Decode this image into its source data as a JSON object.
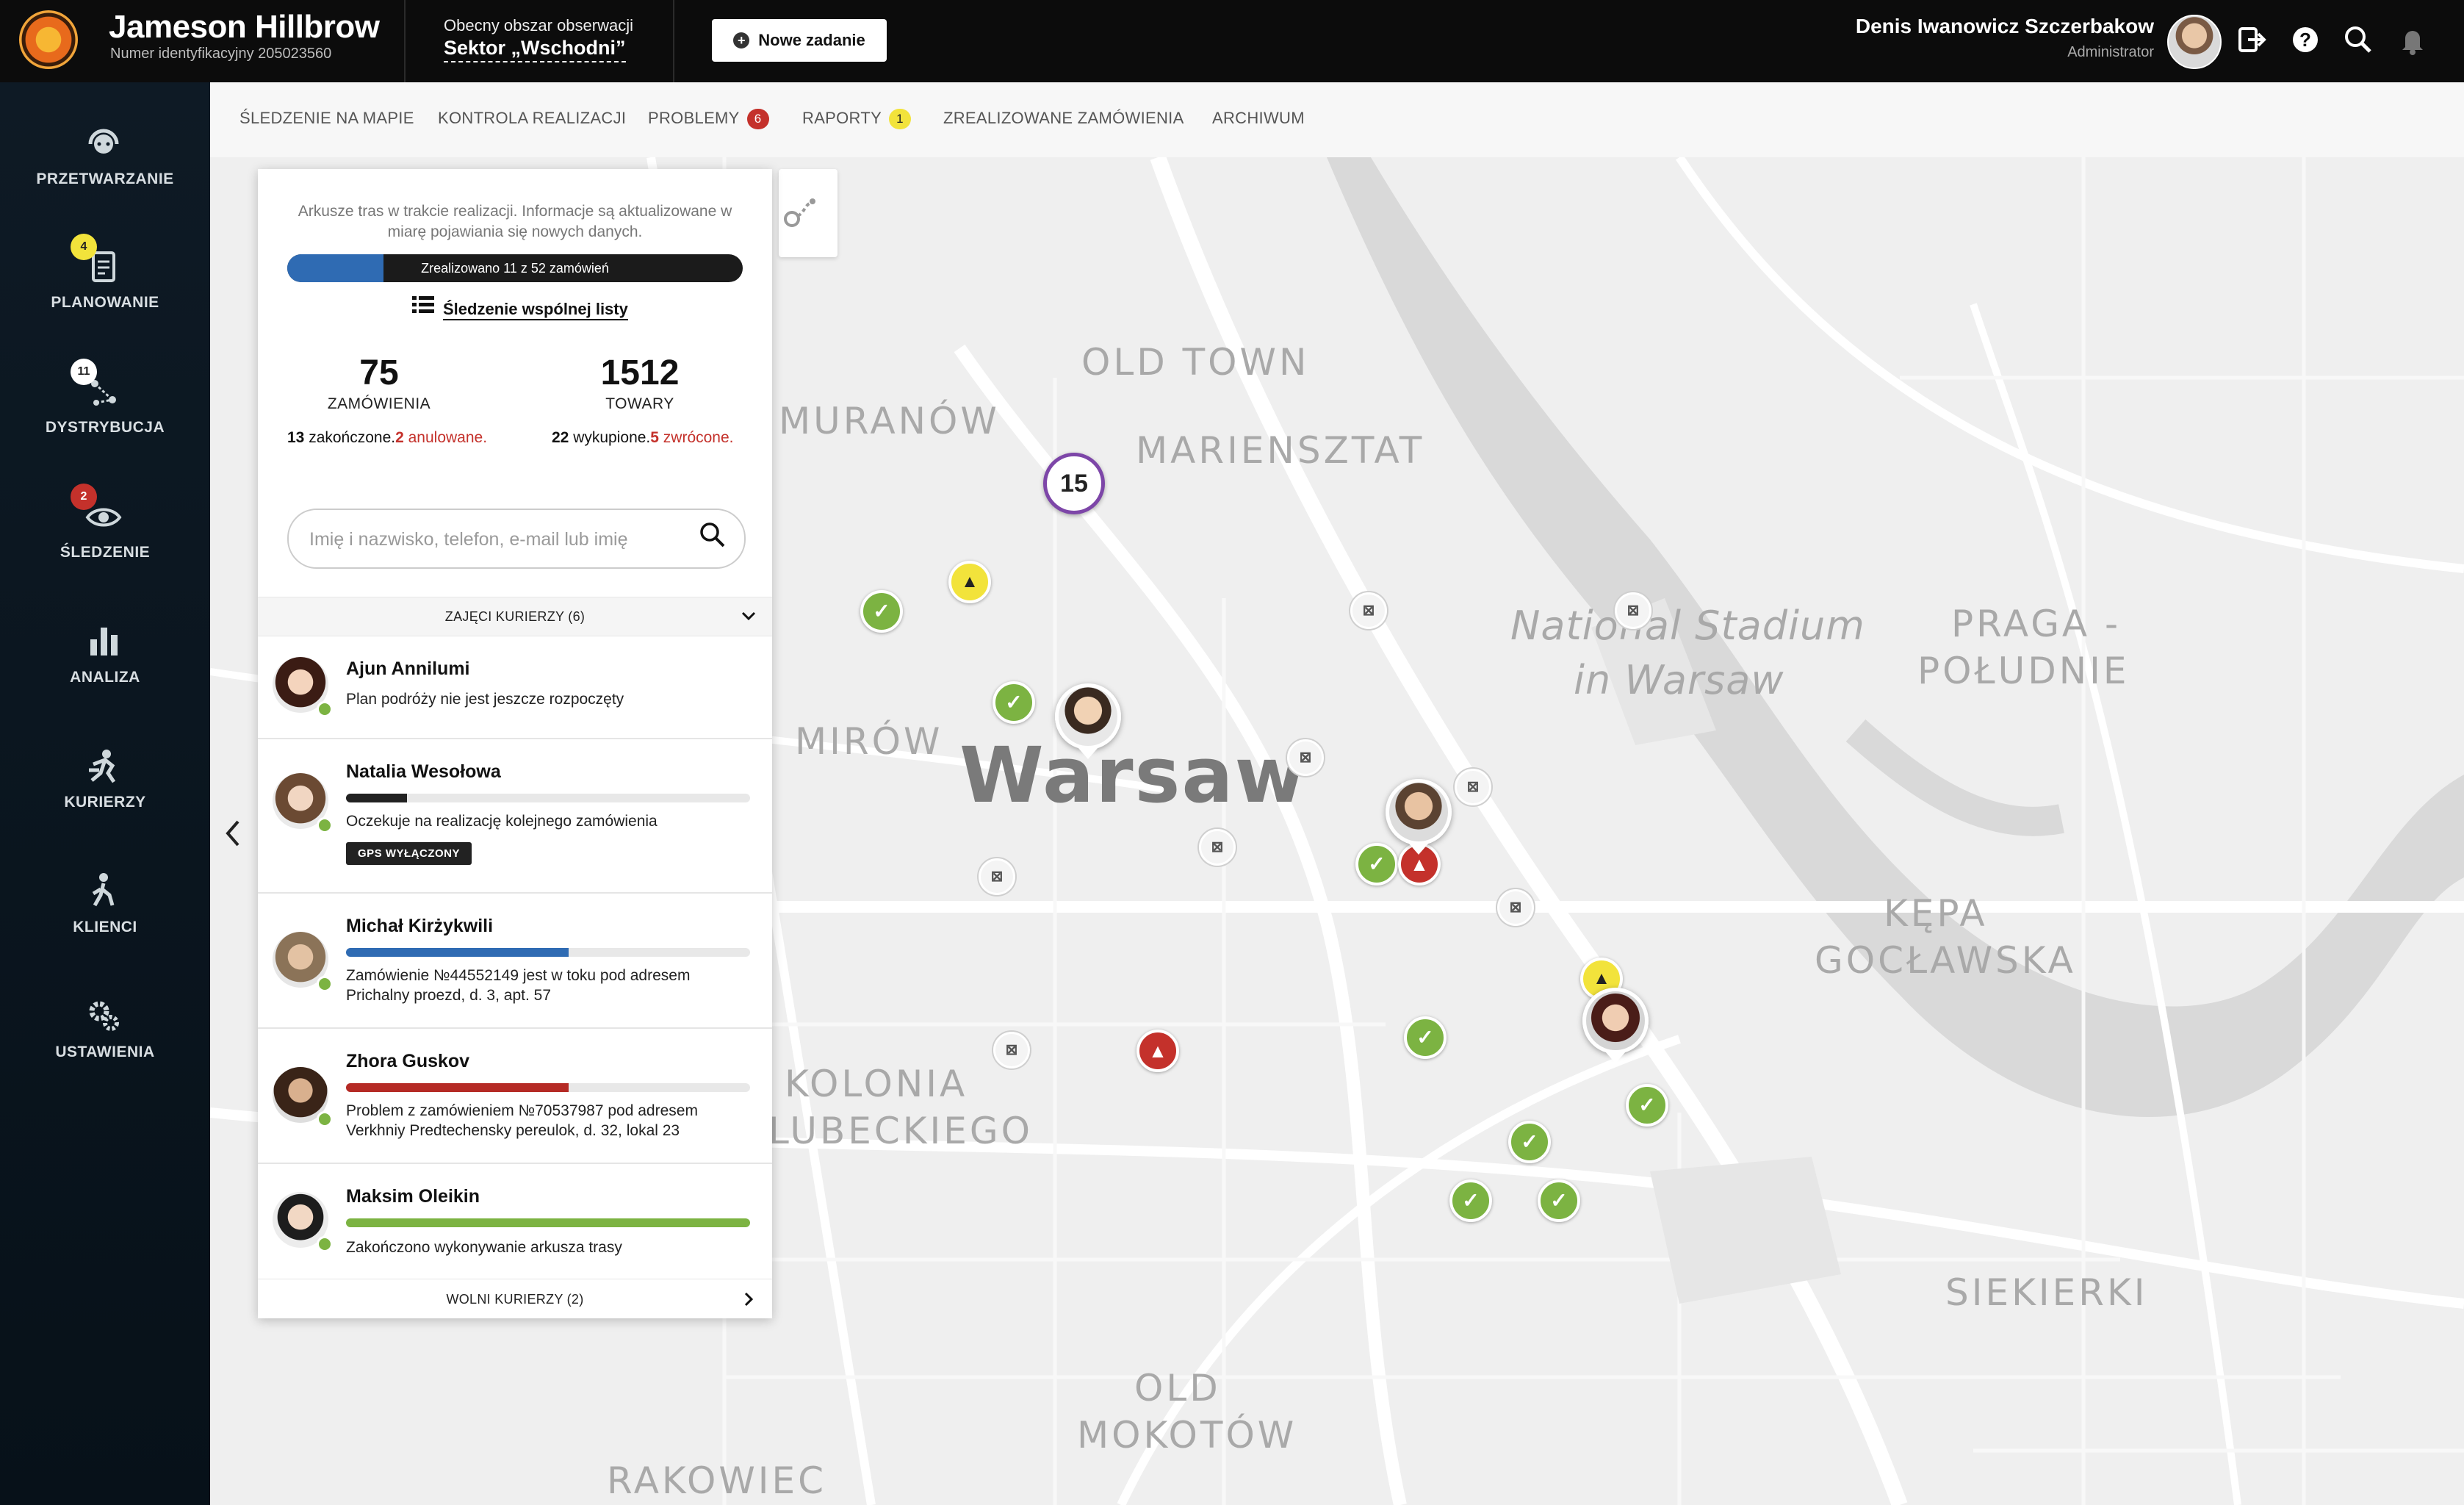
{
  "header": {
    "company_name": "Jameson Hillbrow",
    "company_id": "Numer identyfikacyjny 205023560",
    "area_label": "Obecny obszar obserwacji",
    "area_value": "Sektor „Wschodni”",
    "new_task_label": "Nowe zadanie",
    "user_name": "Denis Iwanowicz Szczerbakow",
    "user_role": "Administrator"
  },
  "nav": {
    "items": [
      {
        "label": "PRZETWARZANIE",
        "icon": "headset-icon",
        "badge": ""
      },
      {
        "label": "PLANOWANIE",
        "icon": "clipboard-icon",
        "badge": "4"
      },
      {
        "label": "DYSTRYBUCJA",
        "icon": "distribution-icon",
        "badge": "11"
      },
      {
        "label": "ŚLEDZENIE",
        "icon": "eye-icon",
        "badge": "2"
      },
      {
        "label": "ANALIZA",
        "icon": "bar-chart-icon",
        "badge": ""
      },
      {
        "label": "KURIERZY",
        "icon": "courier-icon",
        "badge": ""
      },
      {
        "label": "KLIENCI",
        "icon": "person-walk-icon",
        "badge": ""
      },
      {
        "label": "USTAWIENIA",
        "icon": "gears-icon",
        "badge": ""
      }
    ]
  },
  "tabs": [
    {
      "label": "ŚLEDZENIE NA MAPIE",
      "badge": ""
    },
    {
      "label": "KONTROLA REALIZACJI",
      "badge": ""
    },
    {
      "label": "PROBLEMY",
      "badge": "6"
    },
    {
      "label": "RAPORTY",
      "badge": "1"
    },
    {
      "label": "ZREALIZOWANE ZAMÓWIENIA",
      "badge": ""
    },
    {
      "label": "ARCHIWUM",
      "badge": ""
    }
  ],
  "map": {
    "labels": [
      "OLD TOWN",
      "MURANÓW",
      "MARIENSZTAT",
      "National Stadium",
      "in Warsaw",
      "PRAGA -",
      "POŁUDNIE",
      "MIRÓW",
      "Warsaw",
      "KĘPA",
      "GOCŁAWSKA",
      "KOLONIA",
      "LUBECKIEGO",
      "SIEKIERKI",
      "OLD",
      "MOKOTÓW",
      "RAKOWIEC"
    ],
    "cluster_count": "15"
  },
  "panel": {
    "intro": "Arkusze tras w trakcie realizacji. Informacje są aktualizowane w miarę pojawiania się nowych danych.",
    "progress_label": "Zrealizowano 11 z 52 zamówień",
    "progress_done": 11,
    "progress_total": 52,
    "shared_list_link": "Śledzenie wspólnej listy",
    "orders_count": "75",
    "orders_label": "ZAMÓWIENIA",
    "orders_completed_num": "13",
    "orders_completed_txt": " zakończone.",
    "orders_cancelled_num": "2",
    "orders_cancelled_txt": " anulowane.",
    "goods_count": "1512",
    "goods_label": "TOWARY",
    "goods_bought_num": "22",
    "goods_bought_txt": " wykupione.",
    "goods_returned_num": "5",
    "goods_returned_txt": " zwrócone.",
    "search_placeholder": "Imię i nazwisko, telefon, e-mail lub imię",
    "busy_header": "ZAJĘCI KURIERZY (6)",
    "free_header": "WOLNI KURIERZY (2)",
    "couriers": [
      {
        "name": "Ajun Annilumi",
        "status": "Plan podróży nie jest jeszcze rozpoczęty",
        "progress": null,
        "bar_color": "",
        "badge": ""
      },
      {
        "name": "Natalia Wesołowa",
        "status": "Oczekuje na realizację kolejnego zamówienia",
        "progress": 0.15,
        "bar_color": "#222222",
        "badge": "GPS WYŁĄCZONY"
      },
      {
        "name": "Michał Kirżykwili",
        "status": "Zamówienie №44552149 jest w toku pod adresem Prichalny proezd, d. 3, apt. 57",
        "progress": 0.55,
        "bar_color": "#2f6bb3",
        "badge": ""
      },
      {
        "name": "Zhora Guskov",
        "status": "Problem z zamówieniem №70537987 pod adresem Verkhniy Predtechensky pereulok, d. 32, lokal 23",
        "progress": 0.55,
        "bar_color": "#b52a25",
        "badge": ""
      },
      {
        "name": "Maksim Oleikin",
        "status": "Zakończono wykonywanie arkusza trasy",
        "progress": 1.0,
        "bar_color": "#7cb342",
        "badge": ""
      }
    ]
  },
  "colors": {
    "accent_blue": "#2f6bb3",
    "ok_green": "#7cb342",
    "alert_red": "#c4312b",
    "warn_yellow": "#f2e33b",
    "cluster_purple": "#7d46a8"
  }
}
